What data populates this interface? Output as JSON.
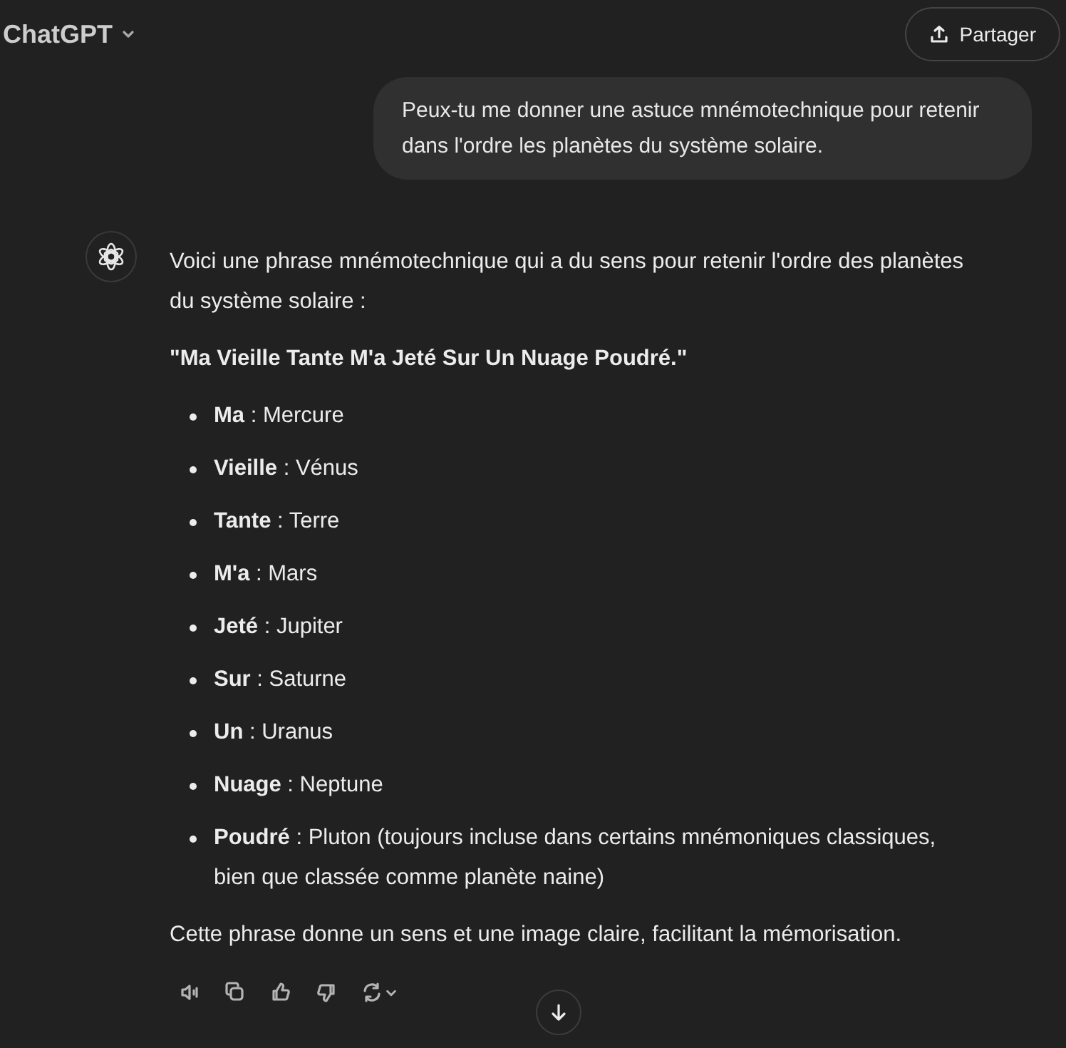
{
  "header": {
    "title": "ChatGPT",
    "share_button": "Partager"
  },
  "user_message": "Peux-tu me donner une astuce mnémotechnique pour retenir dans l'ordre les planètes du système solaire.",
  "assistant_message": {
    "intro": "Voici une phrase mnémotechnique qui a du sens pour retenir l'ordre des planètes du système solaire :",
    "phrase": "\"Ma Vieille Tante M'a Jeté Sur Un Nuage Poudré.\"",
    "items": [
      {
        "word": "Ma",
        "text": " : Mercure"
      },
      {
        "word": "Vieille",
        "text": " : Vénus"
      },
      {
        "word": "Tante",
        "text": " : Terre"
      },
      {
        "word": "M'a",
        "text": " : Mars"
      },
      {
        "word": "Jeté",
        "text": " : Jupiter"
      },
      {
        "word": "Sur",
        "text": " : Saturne"
      },
      {
        "word": "Un",
        "text": " : Uranus"
      },
      {
        "word": "Nuage",
        "text": " : Neptune"
      },
      {
        "word": "Poudré",
        "text": " : Pluton (toujours incluse dans certains mnémoniques classiques, bien que classée comme planète naine)"
      }
    ],
    "conclusion": "Cette phrase donne un sens et une image claire, facilitant la mémorisation."
  }
}
